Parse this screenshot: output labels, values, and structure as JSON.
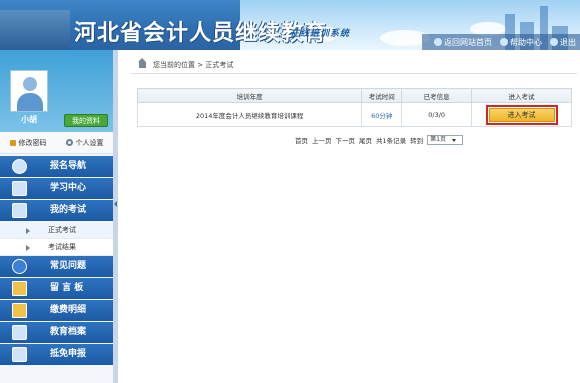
{
  "header": {
    "title": "河北省会计人员继续教育",
    "subtitle": "在线培训系统",
    "links": [
      {
        "label": "返回网站首页",
        "icon": "home-icon"
      },
      {
        "label": "帮助中心",
        "icon": "help-icon"
      },
      {
        "label": "退出",
        "icon": "exit-icon"
      }
    ]
  },
  "profile": {
    "username": "小胡",
    "my_info_label": "我的资料",
    "change_password_label": "修改密码",
    "personal_settings_label": "个人设置"
  },
  "nav": {
    "items": [
      {
        "label": "报名导航",
        "icon": "compass-icon"
      },
      {
        "label": "学习中心",
        "icon": "monitor-icon"
      },
      {
        "label": "我的考试",
        "icon": "checklist-icon"
      }
    ],
    "subitems": [
      {
        "label": "正式考试"
      },
      {
        "label": "考试结果"
      }
    ],
    "items_after": [
      {
        "label": "常见问题",
        "icon": "help-icon"
      },
      {
        "label": "留 言 板",
        "icon": "message-icon"
      },
      {
        "label": "缴费明细",
        "icon": "folder-icon"
      },
      {
        "label": "教育档案",
        "icon": "archive-icon"
      },
      {
        "label": "抵免申报",
        "icon": "declare-icon"
      }
    ]
  },
  "breadcrumb": {
    "text": "您当前的位置 > 正式考试"
  },
  "table": {
    "headers": [
      "培训年度",
      "考试时间",
      "已考信息",
      "进入考试"
    ],
    "rows": [
      {
        "year": "2014年度会计人员继续教育培训课程",
        "duration": "60分钟",
        "attempts": "0/3/0",
        "action": "进入考试"
      }
    ]
  },
  "pager": {
    "first": "首页",
    "prev": "上一页",
    "next": "下一页",
    "last": "尾页",
    "total": "共1条记录",
    "goto_label": "转到",
    "current_page": "第1页"
  },
  "colors": {
    "nav_blue": "#1c5aa5",
    "highlight_red": "#d62424",
    "button_gold": "#f0b326"
  }
}
